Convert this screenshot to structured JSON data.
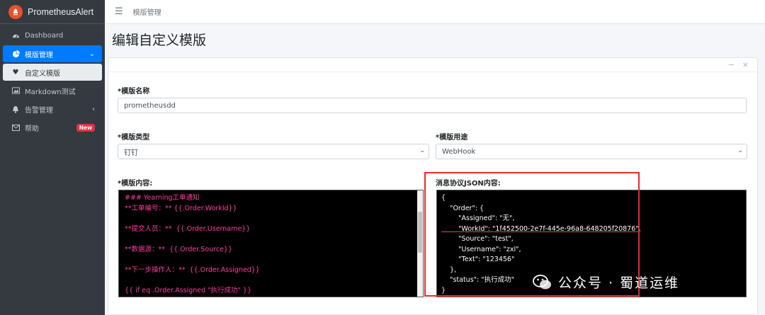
{
  "app": {
    "brand": "PrometheusAlert"
  },
  "sidebar": {
    "items": [
      {
        "label": "Dashboard",
        "icon": "dashboard-icon"
      },
      {
        "label": "模版管理",
        "icon": "chart-pie-icon"
      },
      {
        "label": "自定义模版",
        "icon": "heart-icon"
      },
      {
        "label": "Markdown测试",
        "icon": "image-icon"
      },
      {
        "label": "告警管理",
        "icon": "bell-icon"
      },
      {
        "label": "帮助",
        "icon": "envelope-icon",
        "badge": "New"
      }
    ]
  },
  "topbar": {
    "breadcrumb": "模版管理"
  },
  "page": {
    "title": "编辑自定义模版"
  },
  "form": {
    "name_label": "*模版名称",
    "name_value": "prometheusdd",
    "type_label": "*模版类型",
    "type_value": "钉钉",
    "usage_label": "*模版用途",
    "usage_value": "WebHook",
    "content_label": "*模版内容:",
    "json_label": "消息协议JSON内容:"
  },
  "template_lines": [
    "### Yearning工单通知",
    "**工单编号：** {{.Order.WorkId}}",
    "",
    "**提交人员：**  {{.Order.Username}}",
    "",
    "**数据源：**  {{.Order.Source}}",
    "",
    "**下一步操作人：**  {{.Order.Assigned}}",
    "",
    "{{ if eq .Order.Assigned \"执行成功\" }}"
  ],
  "json_lines": [
    "{",
    "    \"Order\": {",
    "        \"Assigned\": \"无\",",
    "        \"WorkId\": \"1f452500-2e7f-445e-96a8-648205f20876\",",
    "        \"Source\": \"test\",",
    "        \"Username\": \"zxl\",",
    "        \"Text\": \"123456\"",
    "    },",
    "    \"status\": \"执行成功\"",
    "}"
  ],
  "watermark": "公众号 · 蜀道运维",
  "colors": {
    "sidebar_bg": "#343a40",
    "active": "#007bff",
    "template_text": "#ff3c9e",
    "highlight": "#e32c2c"
  }
}
